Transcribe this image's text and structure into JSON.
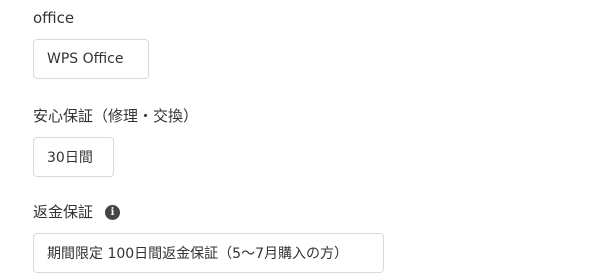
{
  "sections": [
    {
      "label": "office",
      "option": "WPS Office"
    },
    {
      "label": "安心保証（修理・交換）",
      "option": "30日間"
    },
    {
      "label": "返金保証",
      "info_icon": "info-icon",
      "option": "期間限定 100日間返金保証（5〜7月購入の方）"
    }
  ]
}
